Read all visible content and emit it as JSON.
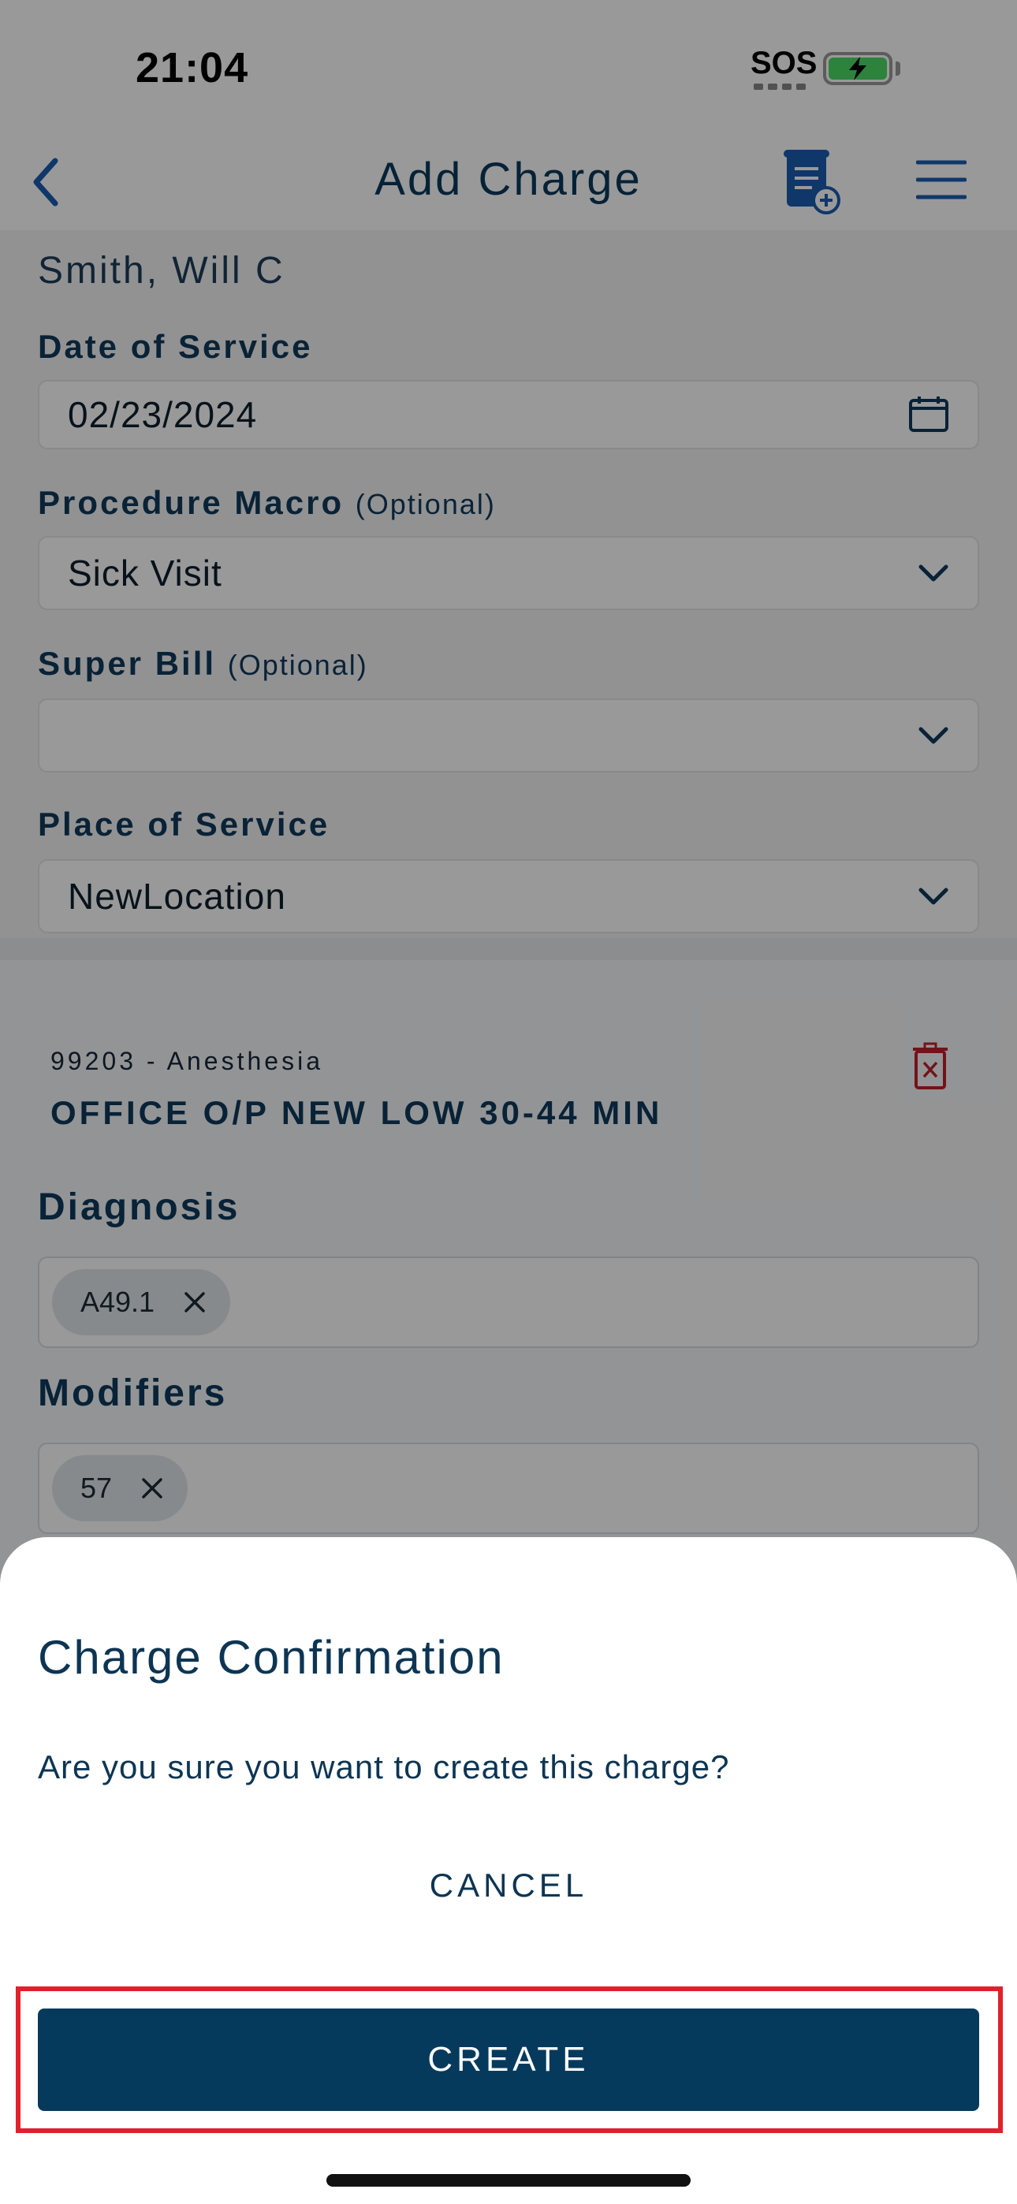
{
  "status_bar": {
    "time": "21:04",
    "sos": "SOS"
  },
  "header": {
    "title": "Add Charge"
  },
  "patient": {
    "name": "Smith, Will C"
  },
  "form": {
    "date_label": "Date of Service",
    "date_value": "02/23/2024",
    "macro_label": "Procedure Macro",
    "macro_optional": "(Optional)",
    "macro_value": "Sick Visit",
    "superbill_label": "Super Bill",
    "superbill_optional": "(Optional)",
    "superbill_value": "",
    "place_label": "Place of Service",
    "place_value": "NewLocation"
  },
  "procedure": {
    "code_line": "99203 - Anesthesia",
    "description": "OFFICE O/P NEW LOW 30-44 MIN",
    "diagnosis_label": "Diagnosis",
    "diagnosis_chips": [
      "A49.1"
    ],
    "modifiers_label": "Modifiers",
    "modifier_chips": [
      "57"
    ]
  },
  "dialog": {
    "title": "Charge Confirmation",
    "message": "Are you sure you want to create this charge?",
    "cancel_label": "CANCEL",
    "create_label": "CREATE"
  },
  "colors": {
    "primary": "#063a5c",
    "text": "#0d3553",
    "highlight": "#e0202a",
    "delete": "#c0202a"
  },
  "icons": [
    "back-icon",
    "add-document-icon",
    "menu-icon",
    "calendar-icon",
    "chevron-down-icon",
    "trash-icon",
    "close-icon"
  ]
}
